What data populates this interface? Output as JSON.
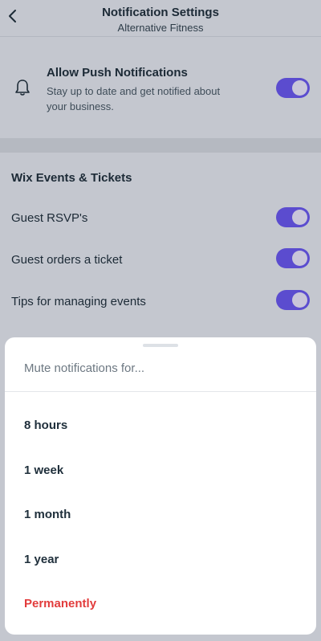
{
  "header": {
    "title": "Notification Settings",
    "subtitle": "Alternative Fitness"
  },
  "push": {
    "title": "Allow Push Notifications",
    "description": "Stay up to date and get notified about your business.",
    "enabled": true,
    "icon": "bell-icon"
  },
  "section": {
    "title": "Wix Events & Tickets",
    "items": [
      {
        "label": "Guest RSVP's",
        "enabled": true
      },
      {
        "label": "Guest orders a ticket",
        "enabled": true
      },
      {
        "label": "Tips for managing events",
        "enabled": true
      }
    ]
  },
  "sheet": {
    "title": "Mute notifications for...",
    "options": [
      {
        "label": "8 hours"
      },
      {
        "label": "1 week"
      },
      {
        "label": "1 month"
      },
      {
        "label": "1 year"
      },
      {
        "label": "Permanently"
      }
    ]
  },
  "colors": {
    "accent": "#5b4ccf",
    "danger": "#e23c3c",
    "overlay_background": "#c4c7cf"
  }
}
